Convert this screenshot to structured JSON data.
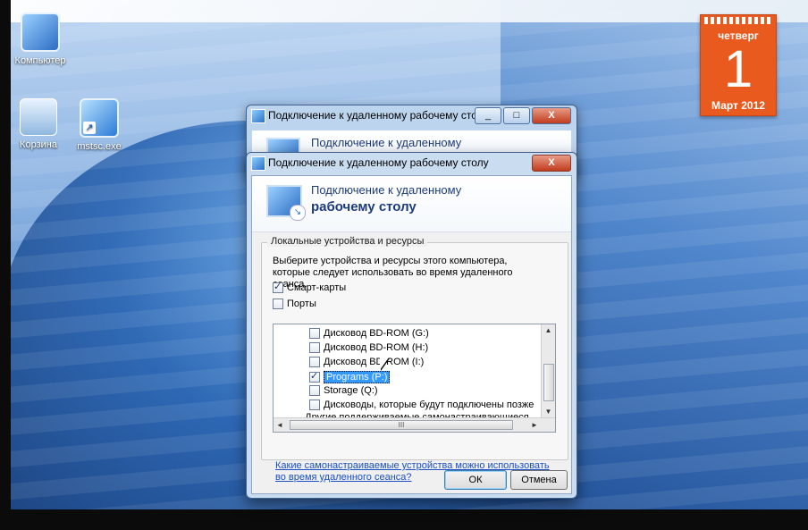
{
  "desktop": {
    "icons": [
      {
        "label": "Компьютер"
      },
      {
        "label": "Корзина"
      },
      {
        "label": "mstsc.exe"
      }
    ]
  },
  "calendar_widget": {
    "day_of_week": "четверг",
    "day": "1",
    "month_year": "Март 2012"
  },
  "back_window": {
    "title": "Подключение к удаленному рабочему столу",
    "header_line1": "Подключение к удаленному",
    "minimize": "_",
    "maximize": "□",
    "close": "X"
  },
  "dialog": {
    "title": "Подключение к удаленному рабочему столу",
    "close": "X",
    "header_line1": "Подключение к удаленному",
    "header_line2": "рабочему столу",
    "group_title": "Локальные устройства и ресурсы",
    "description": "Выберите устройства и ресурсы этого компьютера, которые следует использовать во время удаленного сеанса.",
    "options": [
      {
        "label": "Смарт-карты",
        "checked": true
      },
      {
        "label": "Порты",
        "checked": false
      }
    ],
    "tree_items": [
      {
        "label": "Дисковод BD-ROM (G:)",
        "checked": false
      },
      {
        "label": "Дисковод BD-ROM (H:)",
        "checked": false
      },
      {
        "label": "Дисковод BD-ROM (I:)",
        "checked": false
      },
      {
        "label": "Programs (P:)",
        "checked": true,
        "selected": true
      },
      {
        "label": "Storage (Q:)",
        "checked": false
      },
      {
        "label": "Дисководы, которые будут подключены позже",
        "checked": false
      },
      {
        "label": "Другие поддерживаемые самонастраивающиеся устройс",
        "checked": false,
        "expandable": true
      }
    ],
    "expand_glyph": "+",
    "link": "Какие самонастраиваемые устройства можно использовать во время удаленного сеанса?",
    "ok_label": "ОК",
    "cancel_label": "Отмена",
    "scroll_up": "▲",
    "scroll_down": "▼",
    "scroll_left": "◄",
    "scroll_right": "►",
    "scroll_grip": "III"
  }
}
